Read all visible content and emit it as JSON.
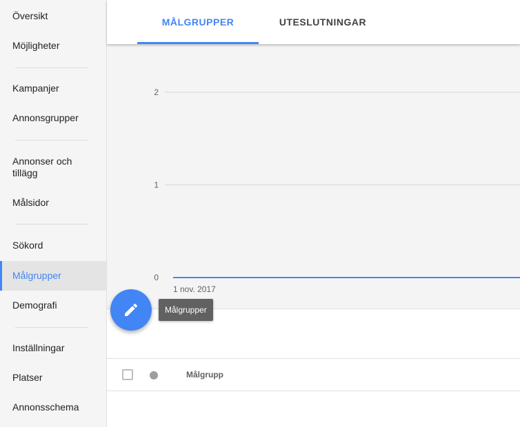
{
  "sidebar": {
    "items": [
      {
        "label": "Översikt"
      },
      {
        "label": "Möjligheter"
      },
      {
        "label": "Kampanjer"
      },
      {
        "label": "Annonsgrupper"
      },
      {
        "label": "Annonser och tillägg"
      },
      {
        "label": "Målsidor"
      },
      {
        "label": "Sökord"
      },
      {
        "label": "Målgrupper",
        "active": true
      },
      {
        "label": "Demografi"
      },
      {
        "label": "Inställningar"
      },
      {
        "label": "Platser"
      },
      {
        "label": "Annonsschema"
      }
    ]
  },
  "tabs": [
    {
      "label": "MÅLGRUPPER",
      "active": true
    },
    {
      "label": "UTESLUTNINGAR",
      "active": false
    }
  ],
  "chart_data": {
    "type": "line",
    "x": [
      "1 nov. 2017"
    ],
    "series": [
      {
        "values": [
          0
        ]
      }
    ],
    "yticks": [
      "2",
      "1",
      "0"
    ],
    "ylim": [
      0,
      2
    ],
    "grid": true,
    "line_color": "#4285f4"
  },
  "fab": {
    "icon": "pencil-icon"
  },
  "tooltip": {
    "text": "Målgrupper"
  },
  "table": {
    "columns": [
      "Målgrupp"
    ]
  },
  "colors": {
    "accent": "#4285f4",
    "sidebar_bg": "#f5f5f5",
    "chart_bg": "#f4f4f4"
  }
}
